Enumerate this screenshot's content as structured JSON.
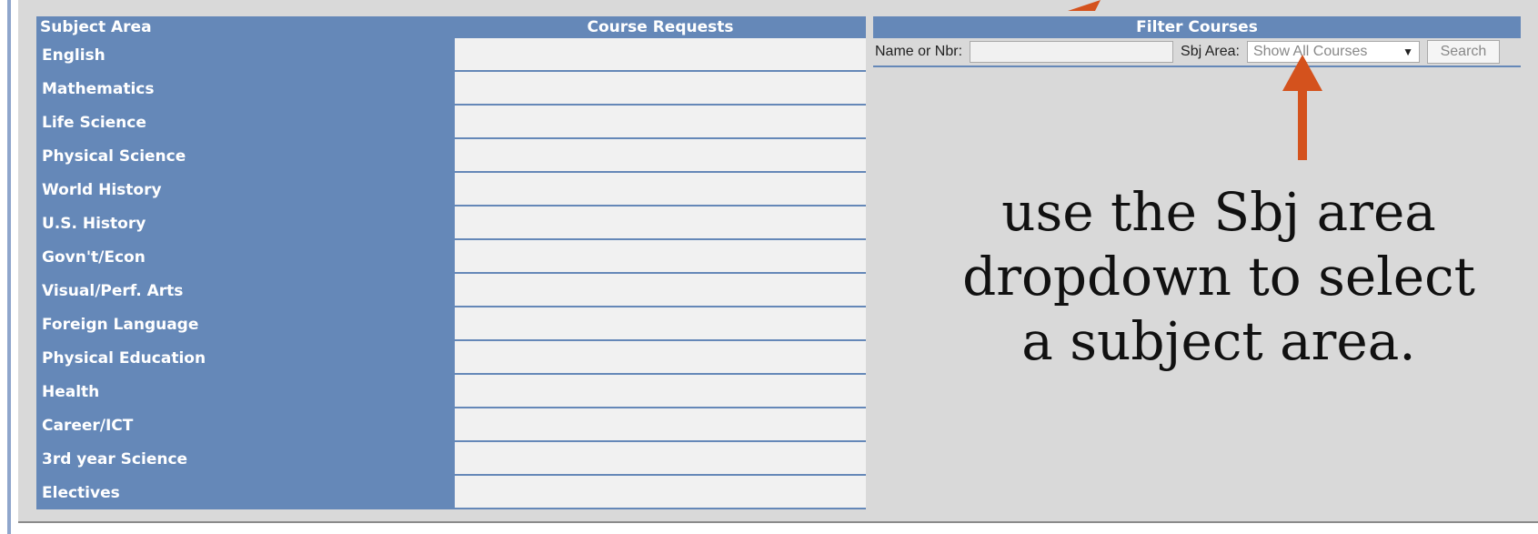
{
  "requests_table": {
    "header_subject": "Subject Area",
    "header_requests": "Course Requests",
    "subjects": [
      "English",
      "Mathematics",
      "Life Science",
      "Physical Science",
      "World History",
      "U.S. History",
      "Govn't/Econ",
      "Visual/Perf. Arts",
      "Foreign Language",
      "Physical Education",
      "Health",
      "Career/ICT",
      "3rd year Science",
      "Electives"
    ],
    "requests": [
      "",
      "",
      "",
      "",
      "",
      "",
      "",
      "",
      "",
      "",
      "",
      "",
      "",
      ""
    ]
  },
  "filter": {
    "title": "Filter Courses",
    "name_label": "Name or Nbr:",
    "name_value": "",
    "sbj_label": "Sbj Area:",
    "sbj_selected": "Show All Courses",
    "search_label": "Search"
  },
  "annotation": {
    "lines": [
      "use the Sbj area",
      "dropdown to select",
      "a subject area."
    ],
    "arrow_color": "#d4521d"
  },
  "colors": {
    "header_blue": "#6588b8",
    "panel_gray": "#d9d9d9",
    "cell_bg": "#f1f1f1"
  }
}
